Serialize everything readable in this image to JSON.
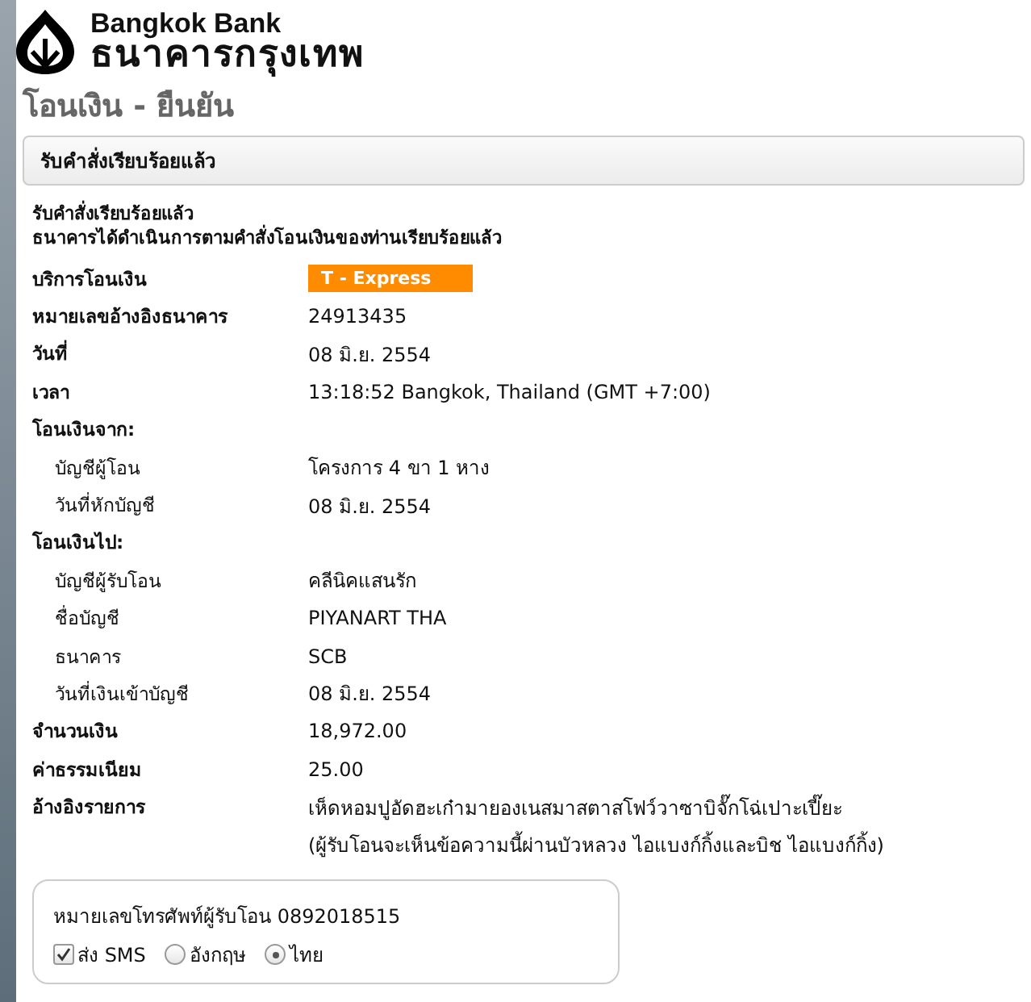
{
  "logo": {
    "name_en": "Bangkok Bank",
    "name_th": "ธนาคารกรุงเทพ"
  },
  "page_title": "โอนเงิน - ยืนยัน",
  "status_header": "รับคำสั่งเรียบร้อยแล้ว",
  "messages": [
    "รับคำสั่งเรียบร้อยแล้ว",
    "ธนาคารได้ดำเนินการตามคำสั่งโอนเงินของท่านเรียบร้อยแล้ว"
  ],
  "details": [
    {
      "kind": "badge",
      "label": "บริการโอนเงิน",
      "value": "T - Express"
    },
    {
      "kind": "field",
      "label": "หมายเลขอ้างอิงธนาคาร",
      "value": "24913435"
    },
    {
      "kind": "field",
      "label": "วันที่",
      "value": "08 มิ.ย. 2554"
    },
    {
      "kind": "field",
      "label": "เวลา",
      "value": "13:18:52 Bangkok, Thailand (GMT +7:00)"
    },
    {
      "kind": "section",
      "label": "โอนเงินจาก:"
    },
    {
      "kind": "subfield",
      "label": "บัญชีผู้โอน",
      "value": "โครงการ 4 ขา 1 หาง"
    },
    {
      "kind": "subfield",
      "label": "วันที่หักบัญชี",
      "value": "08 มิ.ย. 2554"
    },
    {
      "kind": "section",
      "label": "โอนเงินไป:"
    },
    {
      "kind": "subfield",
      "label": "บัญชีผู้รับโอน",
      "value": "คลีนิคแสนรัก"
    },
    {
      "kind": "subfield",
      "label": "ชื่อบัญชี",
      "value": "PIYANART THA"
    },
    {
      "kind": "subfield",
      "label": "ธนาคาร",
      "value": "SCB"
    },
    {
      "kind": "subfield",
      "label": "วันที่เงินเข้าบัญชี",
      "value": "08 มิ.ย. 2554"
    },
    {
      "kind": "field",
      "label": "จำนวนเงิน",
      "value": "18,972.00"
    },
    {
      "kind": "field",
      "label": "ค่าธรรมเนียม",
      "value": "25.00"
    },
    {
      "kind": "field",
      "label": "อ้างอิงรายการ",
      "value": "เห็ดหอมปูอัดฮะเก๋ามายองเนสมาสตาสโฟว์วาซาบิจั๊กโฉ่เปาะเปี๊ยะ"
    },
    {
      "kind": "note",
      "value": "(ผู้รับโอนจะเห็นข้อความนี้ผ่านบัวหลวง ไอแบงก์กิ้งและบิช ไอแบงก์กิ้ง)"
    }
  ],
  "sms": {
    "phone_text": "หมายเลขโทรศัพท์ผู้รับโอน 0892018515",
    "send_label": "ส่ง SMS",
    "send_checked": true,
    "languages": [
      {
        "label": "อังกฤษ",
        "selected": false
      },
      {
        "label": "ไทย",
        "selected": true
      }
    ]
  }
}
